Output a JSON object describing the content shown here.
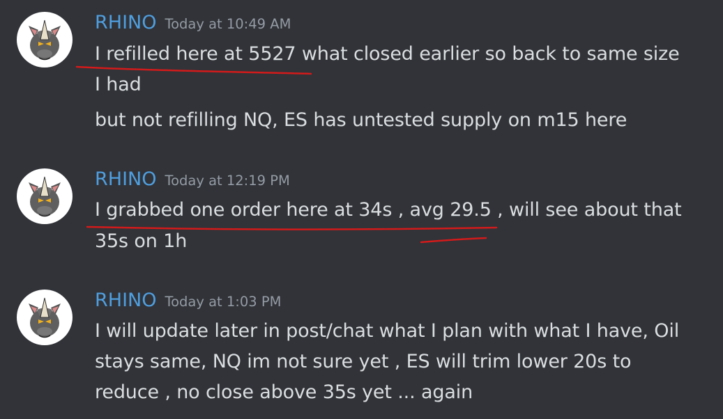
{
  "colors": {
    "background": "#313338",
    "username": "#4f9fe0",
    "timestamp": "#949ba4",
    "message_text": "#dbdee1",
    "annotation": "#d41a1a"
  },
  "messages": [
    {
      "author": "RHINO",
      "avatar_icon": "rhino-avatar",
      "timestamp": "Today at 10:49 AM",
      "lines": [
        "I refilled here at 5527 what closed earlier so back to same size",
        "I had",
        "but not refilling NQ, ES has untested supply on m15 here"
      ]
    },
    {
      "author": "RHINO",
      "avatar_icon": "rhino-avatar",
      "timestamp": "Today at 12:19 PM",
      "lines": [
        "I grabbed one order here at 34s , avg 29.5 , will see about that",
        "35s on 1h"
      ]
    },
    {
      "author": "RHINO",
      "avatar_icon": "rhino-avatar",
      "timestamp": "Today at 1:03 PM",
      "lines": [
        "I will update later in post/chat what I plan with what I have, Oil",
        "stays same, NQ im not sure yet , ES will trim lower 20s to",
        "reduce , no close above 35s yet ... again"
      ]
    }
  ]
}
